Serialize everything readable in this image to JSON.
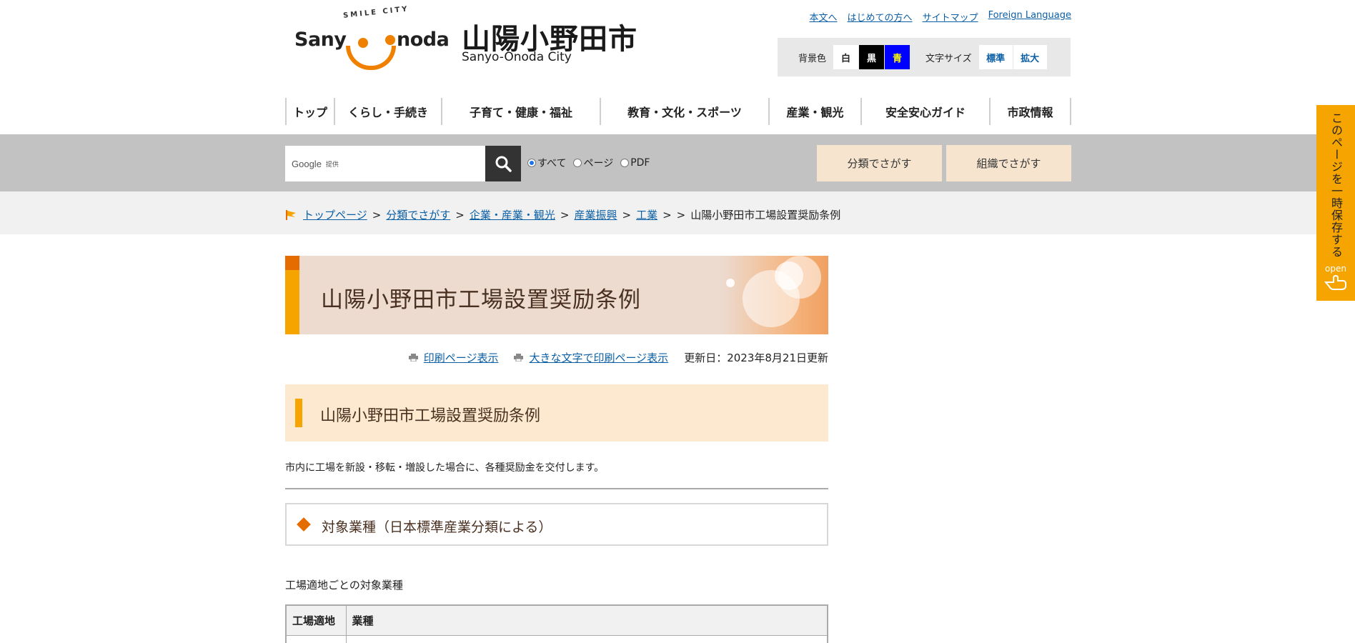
{
  "header": {
    "logo": {
      "smile_city": "SMILE CITY",
      "sanyo": "Sany",
      "onoda": "noda"
    },
    "city_name_jp": "山陽小野田市",
    "city_name_en": "Sanyo-Onoda City",
    "util_links": [
      "本文へ",
      "はじめての方へ",
      "サイトマップ",
      "Foreign Language"
    ],
    "accessibility": {
      "bg_label": "背景色",
      "bg_white": "白",
      "bg_black": "黒",
      "bg_blue": "青",
      "size_label": "文字サイズ",
      "size_standard": "標準",
      "size_large": "拡大"
    }
  },
  "nav": [
    "トップ",
    "くらし・手続き",
    "子育て・健康・福祉",
    "教育・文化・スポーツ",
    "産業・観光",
    "安全安心ガイド",
    "市政情報"
  ],
  "search": {
    "provider": "Google",
    "provider_sub": "提供",
    "radios": [
      "すべて",
      "ページ",
      "PDF"
    ],
    "selected": "すべて",
    "btn_category": "分類でさがす",
    "btn_org": "組織でさがす"
  },
  "breadcrumb": {
    "links": [
      "トップページ",
      "分類でさがす",
      "企業・産業・観光",
      "産業振興",
      "工業"
    ],
    "extra_sep": ">",
    "current": "山陽小野田市工場設置奨励条例"
  },
  "main": {
    "page_title": "山陽小野田市工場設置奨励条例",
    "print_link": "印刷ページ表示",
    "print_large_link": "大きな文字で印刷ページ表示",
    "updated": "更新日：2023年8月21日更新",
    "h2": "山陽小野田市工場設置奨励条例",
    "lead": "市内に工場を新設・移転・増設した場合に、各種奨励金を交付します。",
    "h3": "対象業種（日本標準産業分類による）",
    "sub_label": "工場適地ごとの対象業種",
    "table_headers": [
      "工場適地",
      "業種"
    ]
  },
  "side_tab": {
    "text": "このページを一時保存する",
    "open": "open"
  },
  "colors": {
    "accent_orange": "#e46c00",
    "accent_yellow": "#f5a400",
    "link": "#0b5fa5"
  }
}
